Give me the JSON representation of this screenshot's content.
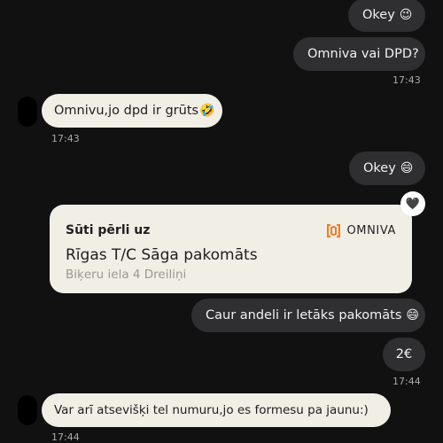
{
  "messages": {
    "m1": {
      "text": "Okey",
      "emoji": "😉"
    },
    "m2": {
      "text": "Omniva vai DPD?",
      "time": "17:43"
    },
    "m3": {
      "text": "Omnivu,jo dpd ir grūts",
      "emoji": "🤣",
      "time": "17:43"
    },
    "m4": {
      "text": "Okey",
      "emoji": "😄"
    },
    "m5": {
      "text": "Caur andeli ir letāks pakomāts",
      "emoji": "😄"
    },
    "m6": {
      "text": "2€",
      "time": "17:44"
    },
    "m7": {
      "text": "Var arī atsevišķi tel numuru,jo es formesu pa jaunu:)",
      "time": "17:44"
    }
  },
  "shipment_card": {
    "heading": "Sūti pērli uz",
    "carrier": "OMNIVA",
    "location_name": "Rīgas T/C Sāga pakomāts",
    "address": "Biķeru iela 4 Dreiliņi",
    "reaction": "🖤"
  },
  "colors": {
    "background": "#111111",
    "outgoing_bubble": "#2f2f31",
    "incoming_bubble": "#f1eee6",
    "omniva_orange": "#ef7d22"
  }
}
